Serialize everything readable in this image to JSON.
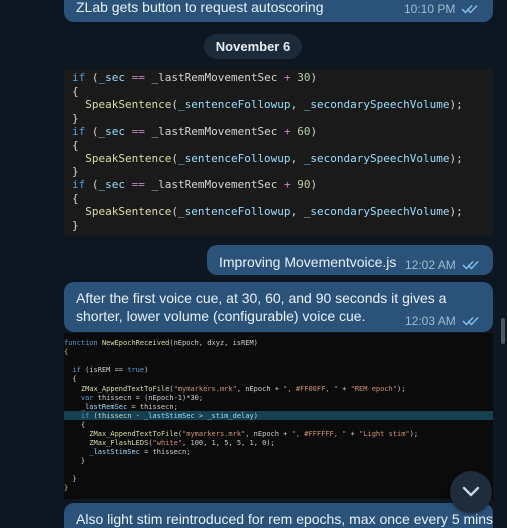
{
  "messages": [
    {
      "text": "ZLab gets button to request autoscoring",
      "time": "10:10 PM"
    },
    {
      "text": "Improving Movementvoice.js",
      "time": "12:02 AM"
    },
    {
      "text": "After the first voice cue, at 30, 60, and 90 seconds it gives a shorter, lower volume (configurable) voice cue.",
      "time": "12:03 AM"
    },
    {
      "text": "Also light stim reintroduced for rem epochs, max once every 5 mins"
    }
  ],
  "date_separator": "November 6",
  "code_block_1": [
    "if (_sec == _lastRemMovementSec + 30)",
    "{",
    "  SpeakSentence(_sentenceFollowup, _secondarySpeechVolume);",
    "}",
    "if (_sec == _lastRemMovementSec + 60)",
    "{",
    "  SpeakSentence(_sentenceFollowup, _secondarySpeechVolume);",
    "}",
    "if (_sec == _lastRemMovementSec + 90)",
    "{",
    "  SpeakSentence(_sentenceFollowup, _secondarySpeechVolume);",
    "}"
  ],
  "code_block_2": [
    "function NewEpochReceived(nEpoch, dxyz, isREM)",
    "{",
    "",
    "  if (isREM == true)",
    "  {",
    "    ZMax_AppendTextToFile(\"mymarkers.mrk\", nEpoch + \", #FF00FF, \" + \"REM epoch\");",
    "    var thissecn = (nEpoch-1)*30;",
    "    _lastRemSec = thissecn;",
    "    if (thissecn - _lastStimSec > _stim_delay)",
    "    {",
    "      ZMax_AppendTextToFile(\"mymarkers.mrk\", nEpoch + \", #FFFFFF, \" + \"Light stim\");",
    "      ZMax_FlashLEDS(\"white\", 100, 1, 5, 5, 1, 0);",
    "      _lastStimSec = thissecn;",
    "    }",
    "",
    "  }",
    "}"
  ],
  "colors": {
    "background": "#0e1621",
    "bubble": "#2b5278",
    "meta": "#9fbcd6"
  },
  "icons": {
    "ticks": "double-check-icon",
    "scroll": "chevron-down-icon"
  }
}
